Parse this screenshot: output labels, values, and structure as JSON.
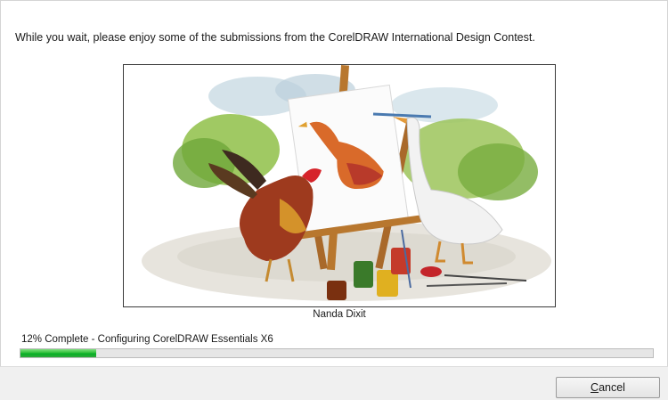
{
  "intro_text": "While you wait, please enjoy some of the submissions from the CorelDRAW International Design Contest.",
  "artwork": {
    "credit": "Nanda Dixit"
  },
  "progress": {
    "status_text": "12% Complete - Configuring CorelDRAW Essentials X6",
    "percent": 12,
    "fill_color": "#06b025"
  },
  "buttons": {
    "cancel_mnemonic": "C",
    "cancel_rest": "ancel"
  }
}
